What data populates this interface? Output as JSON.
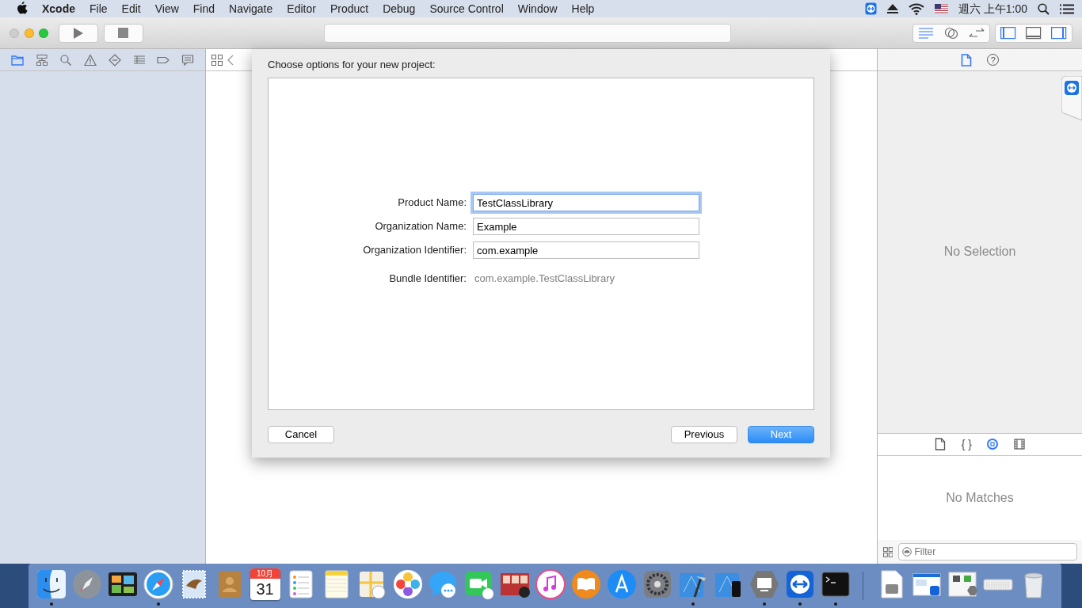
{
  "menu_bar": {
    "app": "Xcode",
    "menus": [
      "File",
      "Edit",
      "View",
      "Find",
      "Navigate",
      "Editor",
      "Product",
      "Debug",
      "Source Control",
      "Window",
      "Help"
    ],
    "clock": "週六 上午1:00"
  },
  "toolbar": {
    "window_buttons": [
      {
        "enabled": false
      },
      {
        "enabled": true
      },
      {
        "enabled": true
      }
    ],
    "editor_modes": [
      {
        "selected": true
      },
      {
        "selected": false
      },
      {
        "selected": false
      }
    ],
    "panels": [
      {
        "shown": true
      },
      {
        "shown": false
      },
      {
        "shown": true
      }
    ]
  },
  "navigator": {
    "tabs": [
      {
        "selected": true
      },
      {
        "selected": false
      },
      {
        "selected": false
      },
      {
        "selected": false
      },
      {
        "selected": false
      },
      {
        "selected": false
      },
      {
        "selected": false
      },
      {
        "selected": false
      }
    ]
  },
  "sheet": {
    "title": "Choose options for your new project:",
    "fields": [
      {
        "kind": "input",
        "label": "Product Name:",
        "value": "TestClassLibrary",
        "focused": true
      },
      {
        "kind": "input",
        "label": "Organization Name:",
        "value": "Example",
        "focused": false
      },
      {
        "kind": "input",
        "label": "Organization Identifier:",
        "value": "com.example",
        "focused": false
      },
      {
        "kind": "static",
        "label": "Bundle Identifier:",
        "value": "com.example.TestClassLibrary"
      }
    ],
    "buttons": [
      {
        "label": "Cancel",
        "default": false
      },
      {
        "label": "Previous",
        "default": false
      },
      {
        "label": "Next",
        "default": true
      }
    ]
  },
  "inspector": {
    "tabs": [
      {
        "selected": true
      },
      {
        "selected": false,
        "glyph": "?"
      }
    ],
    "empty_text": "No Selection"
  },
  "library": {
    "tabs": [
      {
        "selected": false
      },
      {
        "selected": false,
        "glyph": "{ }"
      },
      {
        "selected": true
      },
      {
        "selected": false
      }
    ],
    "empty_text": "No Matches",
    "filter": {
      "placeholder": "Filter"
    }
  },
  "dock": {
    "items": [
      {
        "running": true
      },
      {
        "running": false
      },
      {
        "running": false
      },
      {
        "running": true
      },
      {
        "running": false
      },
      {
        "running": false
      },
      {
        "running": false,
        "month": "10月",
        "day": "31"
      },
      {
        "running": false
      },
      {
        "running": false
      },
      {
        "running": false
      },
      {
        "running": false
      },
      {
        "running": false
      },
      {
        "running": false
      },
      {
        "running": false
      },
      {
        "running": false
      },
      {
        "running": false
      },
      {
        "running": false
      },
      {
        "running": false
      },
      {
        "running": true
      },
      {
        "running": false
      },
      {
        "running": true
      },
      {
        "running": true
      },
      {
        "running": true
      }
    ],
    "others": [
      {
        "running": false
      },
      {
        "running": false
      },
      {
        "running": false
      },
      {
        "running": false
      },
      {
        "running": false
      }
    ]
  }
}
